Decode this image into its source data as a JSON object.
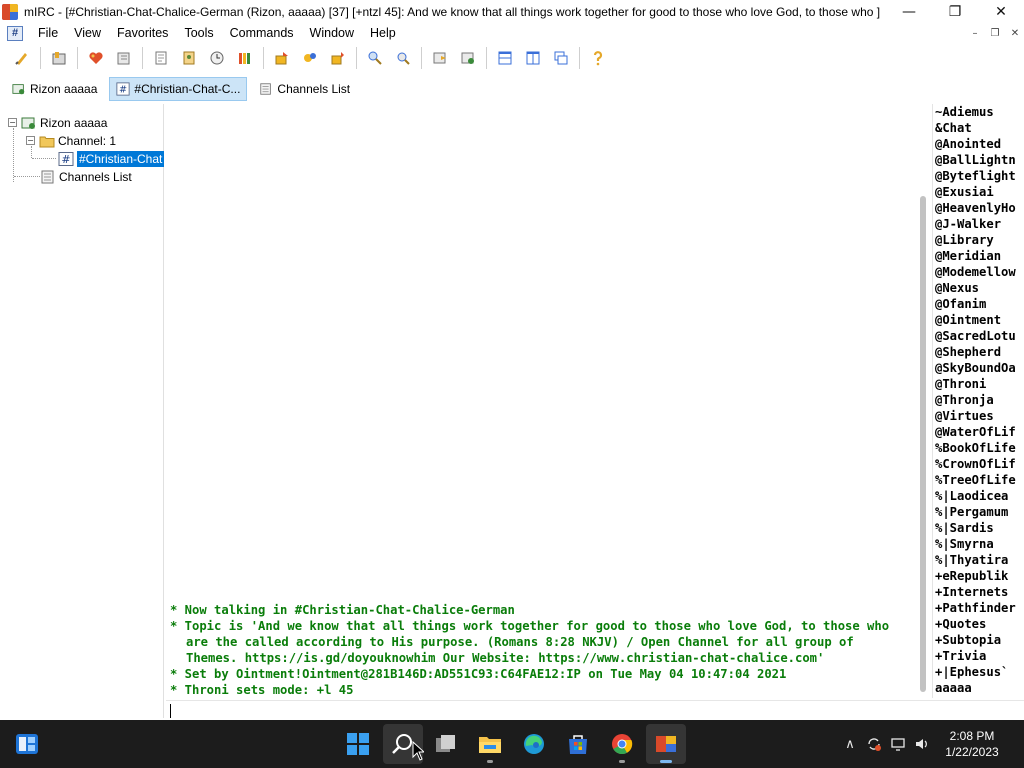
{
  "window": {
    "title": "mIRC - [#Christian-Chat-Chalice-German (Rizon, aaaaa) [37] [+ntzl 45]: And we know that all things work together for good to those who love God, to those who ]",
    "minimize_glyph": "—",
    "maximize_glyph": "❐",
    "close_glyph": "✕"
  },
  "menu": {
    "items": [
      "File",
      "View",
      "Favorites",
      "Tools",
      "Commands",
      "Window",
      "Help"
    ],
    "mdi_minimize": "–",
    "mdi_restore": "❐",
    "mdi_close": "✕"
  },
  "toolbar": {
    "icons": [
      "connect-icon",
      "options-icon",
      "favorites-icon",
      "favorites-manage-icon",
      "scripts-editor-icon",
      "address-book-icon",
      "timer-icon",
      "colors-icon",
      "dcc-send-icon",
      "dcc-chat-icon",
      "dcc-options-icon",
      "notify-list-icon",
      "url-catcher-icon",
      "channels-list-icon",
      "received-files-icon",
      "tile-horizontal-icon",
      "tile-vertical-icon",
      "cascade-icon",
      "help-icon"
    ]
  },
  "switchbar": {
    "items": [
      {
        "label": "Rizon aaaaa",
        "icon": "server-icon",
        "active": false
      },
      {
        "label": "#Christian-Chat-C...",
        "icon": "channel-icon",
        "active": true
      },
      {
        "label": "Channels List",
        "icon": "list-icon",
        "active": false
      }
    ]
  },
  "treebar": {
    "server": "Rizon aaaaa",
    "folder": "Channel: 1",
    "channel": "#Christian-Chat",
    "channels_list": "Channels List",
    "expanded_glyph": "−"
  },
  "chat": {
    "lines": [
      "* Now talking in #Christian-Chat-Chalice-German",
      "* Topic is 'And we know that all things work together for good to those who love God, to those who are the called according to His purpose. (Romans 8:28 NKJV) / Open Channel for all group of Themes. https://is.gd/doyouknowhim Our Website: https://www.christian-chat-chalice.com'",
      "* Set by Ointment!Ointment@281B146D:AD551C93:C64FAE12:IP on Tue May 04 10:47:04 2021",
      "* Throni sets mode: +l 45"
    ],
    "text_color": "#0a7d0a"
  },
  "nicklist": {
    "nicks": [
      "~Adiemus",
      "&Chat",
      "@Anointed",
      "@BallLightn",
      "@Byteflight",
      "@Exusiai",
      "@HeavenlyHo",
      "@J-Walker",
      "@Library",
      "@Meridian",
      "@Modemellow",
      "@Nexus",
      "@Ofanim",
      "@Ointment",
      "@SacredLotu",
      "@Shepherd",
      "@SkyBoundOa",
      "@Throni",
      "@Thronja",
      "@Virtues",
      "@WaterOfLif",
      "%BookOfLife",
      "%CrownOfLif",
      "%TreeOfLife",
      "%|Laodicea",
      "%|Pergamum",
      "%|Sardis",
      "%|Smyrna",
      "%|Thyatira",
      "+eRepublik",
      "+Internets",
      "+Pathfinder",
      "+Quotes",
      "+Subtopia",
      "+Trivia",
      "+|Ephesus`",
      "aaaaa"
    ]
  },
  "taskbar": {
    "apps": [
      {
        "name": "start-icon"
      },
      {
        "name": "search-icon"
      },
      {
        "name": "task-view-icon"
      },
      {
        "name": "file-explorer-icon"
      },
      {
        "name": "edge-icon"
      },
      {
        "name": "microsoft-store-icon"
      },
      {
        "name": "chrome-icon"
      },
      {
        "name": "mirc-icon"
      }
    ],
    "tray": {
      "chevron_glyph": "∧",
      "clock_time": "2:08 PM",
      "clock_date": "1/22/2023"
    }
  }
}
